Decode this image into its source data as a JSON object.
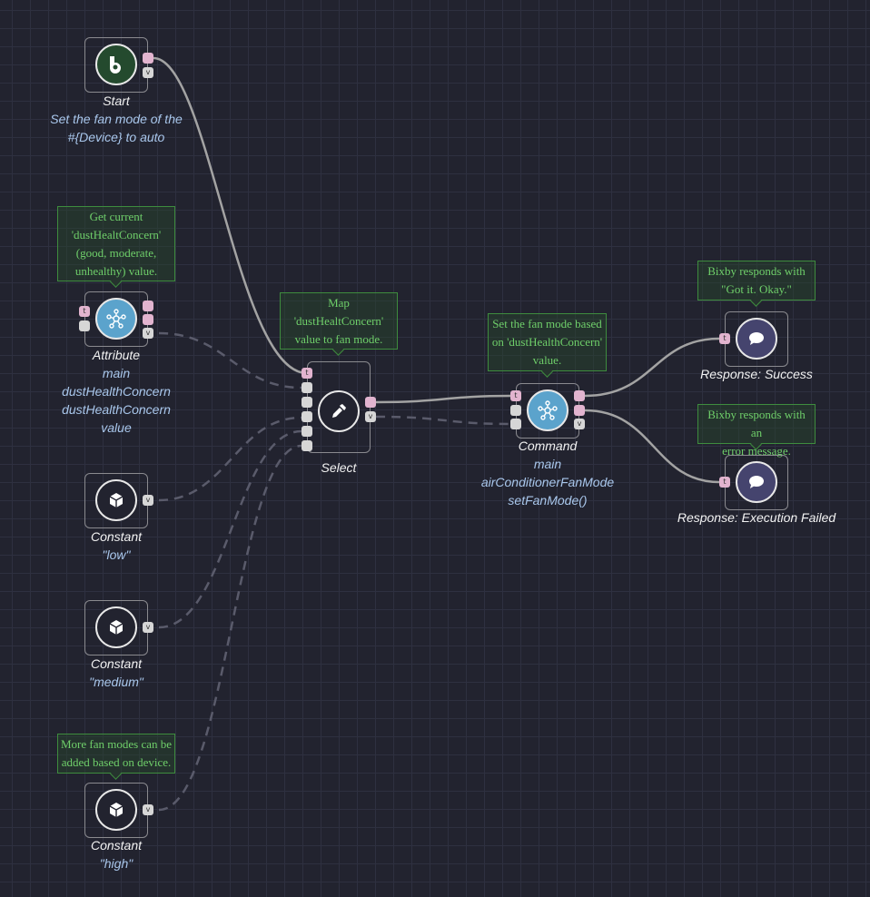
{
  "colors": {
    "background": "#22232f",
    "trigger_port": "#e2b4cf",
    "value_port": "#d6d6d6",
    "note_text": "#6fcf6a",
    "subtitle": "#a9c7ec",
    "start": "#244a2e",
    "device": "#5ba3cc",
    "response": "#45446e"
  },
  "nodes": {
    "start": {
      "title": "Start",
      "lines": [
        "Set the fan mode of the",
        "#{Device} to auto"
      ],
      "icon": "bixby-logo-icon"
    },
    "attribute": {
      "note": [
        "Get current",
        "'dustHealtConcern'",
        "(good, moderate,",
        "unhealthy) value."
      ],
      "title": "Attribute",
      "lines": [
        "main",
        "dustHealthConcern",
        "dustHealthConcern",
        "value"
      ],
      "icon": "device-network-icon"
    },
    "select": {
      "note": [
        "Map",
        "'dustHealtConcern'",
        "value to fan mode."
      ],
      "title": "Select",
      "icon": "eyedropper-icon"
    },
    "command": {
      "note": [
        "Set the fan mode based",
        "on 'dustHealthConcern'",
        "value."
      ],
      "title": "Command",
      "lines": [
        "main",
        "airConditionerFanMode",
        "setFanMode()"
      ],
      "icon": "device-network-icon"
    },
    "success": {
      "note": [
        "Bixby responds with",
        "\"Got it. Okay.\""
      ],
      "title": "Response: Success",
      "icon": "speech-bubble-icon"
    },
    "failed": {
      "note": [
        "Bixby responds with an",
        "error message."
      ],
      "title": "Response: Execution Failed",
      "icon": "speech-bubble-icon"
    },
    "low": {
      "title": "Constant",
      "lines": [
        "\"low\""
      ],
      "icon": "cube-icon"
    },
    "medium": {
      "title": "Constant",
      "lines": [
        "\"medium\""
      ],
      "icon": "cube-icon"
    },
    "high": {
      "note": [
        "More fan modes can be",
        "added based on device."
      ],
      "title": "Constant",
      "lines": [
        "\"high\""
      ],
      "icon": "cube-icon"
    }
  },
  "ports": {
    "trigger": "t",
    "value": "v"
  }
}
